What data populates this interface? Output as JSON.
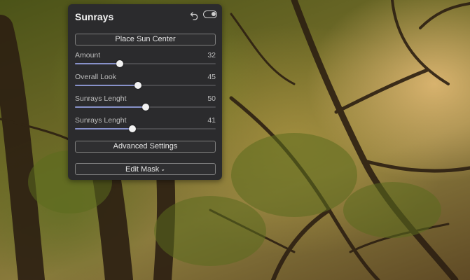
{
  "panel": {
    "title": "Sunrays",
    "toggle_on": true,
    "place_sun_button": "Place Sun Center",
    "sliders": [
      {
        "label": "Amount",
        "value": "32",
        "fraction": 0.32
      },
      {
        "label": "Overall Look",
        "value": "45",
        "fraction": 0.45
      },
      {
        "label": "Sunrays Lenght",
        "value": "50",
        "fraction": 0.5
      },
      {
        "label": "Sunrays Lenght",
        "value": "41",
        "fraction": 0.41
      }
    ],
    "advanced_button": "Advanced Settings",
    "edit_mask_button": "Edit Mask",
    "edit_mask_icon": "chevron-down-icon"
  },
  "colors": {
    "panel_bg": "#2b2b2d",
    "slider_fill": "#8791c9"
  }
}
